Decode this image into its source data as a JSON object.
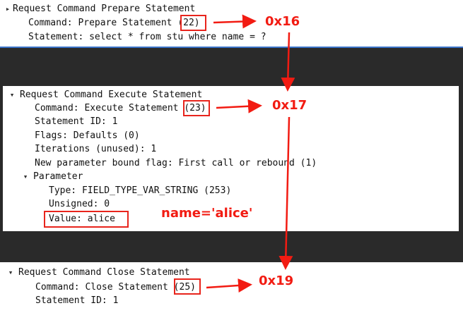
{
  "colors": {
    "annotation": "#f21b12",
    "separator": "#2a2a2a",
    "selection_border": "#3a73c8"
  },
  "icons": {
    "expanded": "chevron-down-icon",
    "collapsed": "chevron-right-icon"
  },
  "prepare": {
    "toggle_glyph": "▸",
    "header": "Request Command Prepare Statement",
    "command_prefix": "Command: Prepare Statement ",
    "command_code": "(22)",
    "statement": "Statement: select * from stu where name = ?"
  },
  "execute": {
    "toggle_glyph": "▾",
    "header": "Request Command Execute Statement",
    "command_prefix": "Command: Execute Statement ",
    "command_code": "(23)",
    "statement_id": "Statement ID: 1",
    "flags": "Flags: Defaults (0)",
    "iterations": "Iterations (unused): 1",
    "bound_flag": "New parameter bound flag: First call or rebound (1)",
    "parameter": {
      "toggle_glyph": "▾",
      "label": "Parameter",
      "type": "Type: FIELD_TYPE_VAR_STRING (253)",
      "unsigned": "Unsigned: 0",
      "value": "Value: alice"
    }
  },
  "close": {
    "toggle_glyph": "▾",
    "header": "Request Command Close Statement",
    "command_prefix": "Command: Close Statement ",
    "command_code": "(25)",
    "statement_id": "Statement ID: 1"
  },
  "annotations": {
    "prepare_hex": "0x16",
    "execute_hex": "0x17",
    "close_hex": "0x19",
    "value_note": "name='alice'"
  }
}
